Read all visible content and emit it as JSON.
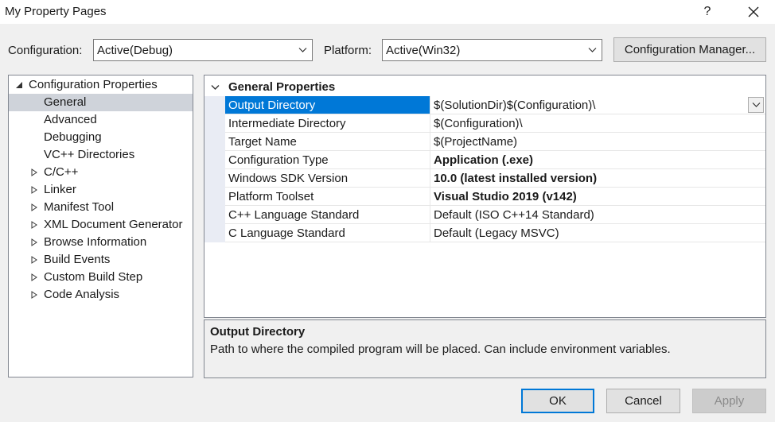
{
  "window": {
    "title": "My Property Pages",
    "help_label": "?",
    "close_icon": "close-icon"
  },
  "toolbar": {
    "configuration_label": "Configuration:",
    "configuration_value": "Active(Debug)",
    "platform_label": "Platform:",
    "platform_value": "Active(Win32)",
    "config_manager_label": "Configuration Manager..."
  },
  "tree": {
    "root": {
      "label": "Configuration Properties",
      "expanded": true
    },
    "items": [
      {
        "label": "General",
        "selected": true,
        "expandable": false
      },
      {
        "label": "Advanced",
        "selected": false,
        "expandable": false
      },
      {
        "label": "Debugging",
        "selected": false,
        "expandable": false
      },
      {
        "label": "VC++ Directories",
        "selected": false,
        "expandable": false
      },
      {
        "label": "C/C++",
        "selected": false,
        "expandable": true
      },
      {
        "label": "Linker",
        "selected": false,
        "expandable": true
      },
      {
        "label": "Manifest Tool",
        "selected": false,
        "expandable": true
      },
      {
        "label": "XML Document Generator",
        "selected": false,
        "expandable": true
      },
      {
        "label": "Browse Information",
        "selected": false,
        "expandable": true
      },
      {
        "label": "Build Events",
        "selected": false,
        "expandable": true
      },
      {
        "label": "Custom Build Step",
        "selected": false,
        "expandable": true
      },
      {
        "label": "Code Analysis",
        "selected": false,
        "expandable": true
      }
    ]
  },
  "grid": {
    "section_title": "General Properties",
    "properties": [
      {
        "name": "Output Directory",
        "value": "$(SolutionDir)$(Configuration)\\",
        "bold": false,
        "selected": true
      },
      {
        "name": "Intermediate Directory",
        "value": "$(Configuration)\\",
        "bold": false,
        "selected": false
      },
      {
        "name": "Target Name",
        "value": "$(ProjectName)",
        "bold": false,
        "selected": false
      },
      {
        "name": "Configuration Type",
        "value": "Application (.exe)",
        "bold": true,
        "selected": false
      },
      {
        "name": "Windows SDK Version",
        "value": "10.0 (latest installed version)",
        "bold": true,
        "selected": false
      },
      {
        "name": "Platform Toolset",
        "value": "Visual Studio 2019 (v142)",
        "bold": true,
        "selected": false
      },
      {
        "name": "C++ Language Standard",
        "value": "Default (ISO C++14 Standard)",
        "bold": false,
        "selected": false
      },
      {
        "name": "C Language Standard",
        "value": "Default (Legacy MSVC)",
        "bold": false,
        "selected": false
      }
    ]
  },
  "description": {
    "title": "Output Directory",
    "text": "Path to where the compiled program will be placed. Can include environment variables."
  },
  "buttons": {
    "ok": "OK",
    "cancel": "Cancel",
    "apply": "Apply"
  },
  "colors": {
    "selection_blue": "#0078d7",
    "tree_selected": "#cfd3da"
  }
}
